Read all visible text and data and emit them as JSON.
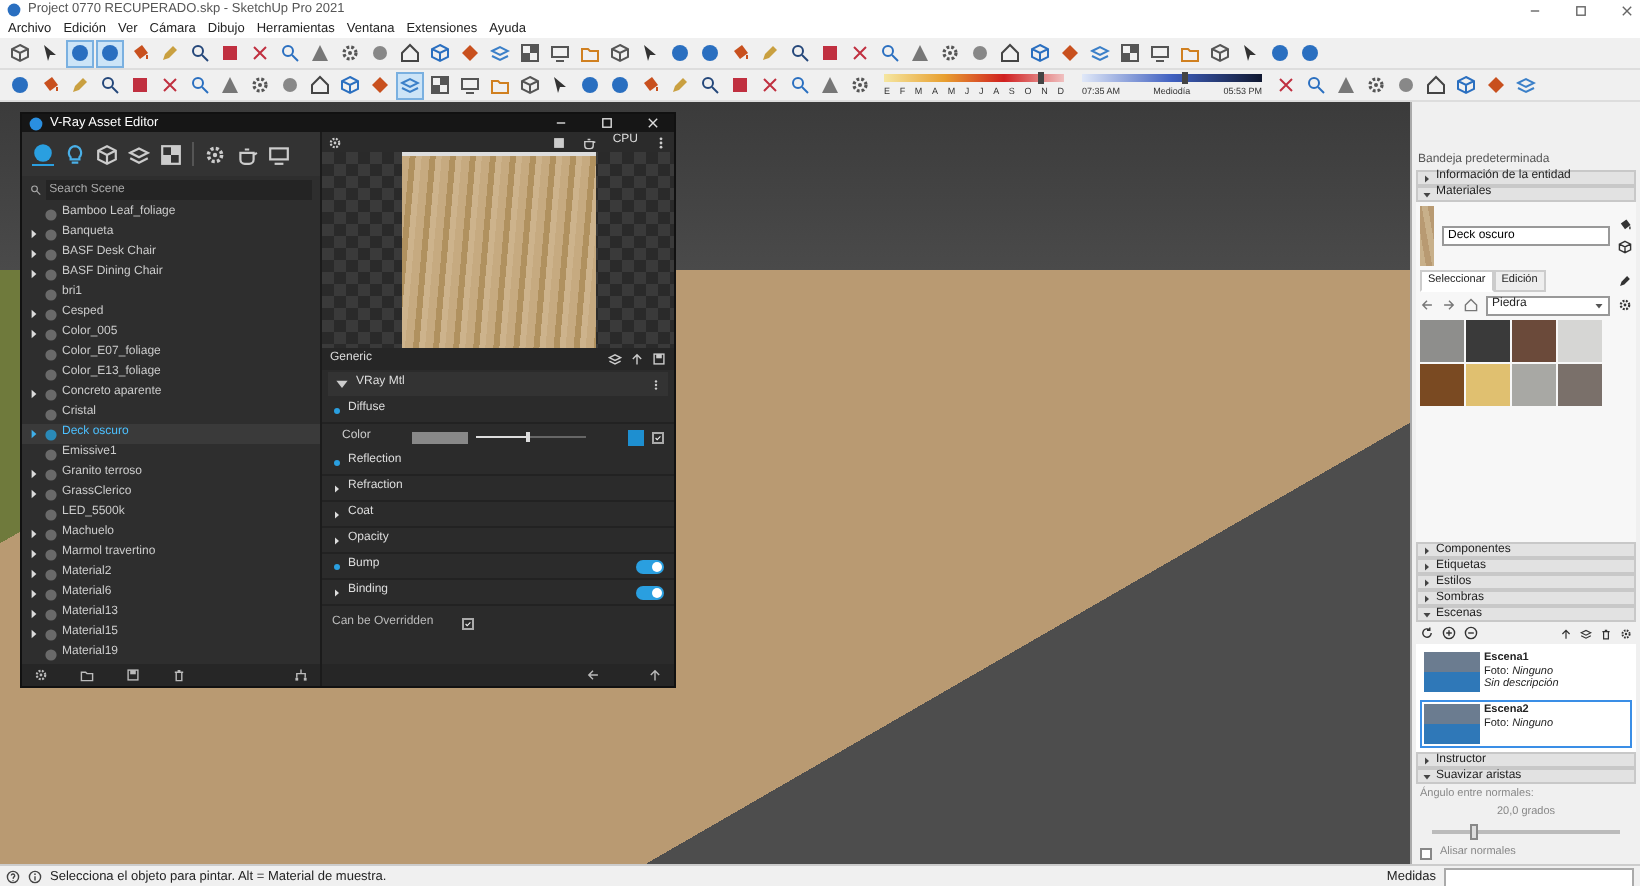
{
  "window": {
    "title": "Project 0770 RECUPERADO.skp - SketchUp Pro 2021"
  },
  "menu": [
    "Archivo",
    "Edición",
    "Ver",
    "Cámara",
    "Dibujo",
    "Herramientas",
    "Ventana",
    "Extensiones",
    "Ayuda"
  ],
  "toolbar_rows": [
    {
      "buttons": [
        {
          "selected": false
        },
        {
          "selected": false
        },
        {
          "selected": true
        },
        {
          "selected": true
        },
        {
          "selected": false
        },
        {
          "selected": false
        },
        {
          "selected": false
        },
        {
          "selected": false
        },
        {
          "selected": false
        },
        {
          "selected": false
        },
        {
          "selected": false
        },
        {
          "selected": false
        },
        {
          "selected": false
        },
        {
          "selected": false
        },
        {
          "selected": false
        },
        {
          "selected": false
        },
        {
          "selected": false
        },
        {
          "selected": false
        },
        {
          "selected": false
        },
        {
          "selected": false
        },
        {
          "selected": false
        },
        {
          "selected": false
        },
        {
          "selected": false
        },
        {
          "selected": false
        },
        {
          "selected": false
        },
        {
          "selected": false
        },
        {
          "selected": false
        },
        {
          "selected": false
        },
        {
          "selected": false
        },
        {
          "selected": false
        },
        {
          "selected": false
        },
        {
          "selected": false
        },
        {
          "selected": false
        },
        {
          "selected": false
        },
        {
          "selected": false
        },
        {
          "selected": false
        },
        {
          "selected": false
        },
        {
          "selected": false
        },
        {
          "selected": false
        },
        {
          "selected": false
        },
        {
          "selected": false
        },
        {
          "selected": false
        },
        {
          "selected": false
        },
        {
          "selected": false
        }
      ]
    },
    {
      "buttons_left": [
        {
          "selected": false
        },
        {
          "selected": false
        },
        {
          "selected": false
        },
        {
          "selected": false
        },
        {
          "selected": false
        },
        {
          "selected": false
        },
        {
          "selected": false
        },
        {
          "selected": false
        },
        {
          "selected": false
        },
        {
          "selected": false
        },
        {
          "selected": false
        },
        {
          "selected": false
        },
        {
          "selected": false
        },
        {
          "selected": true
        },
        {
          "selected": false
        },
        {
          "selected": false
        },
        {
          "selected": false
        },
        {
          "selected": false
        },
        {
          "selected": false
        },
        {
          "selected": false
        },
        {
          "selected": false
        },
        {
          "selected": false
        },
        {
          "selected": false
        },
        {
          "selected": false
        },
        {
          "selected": false
        },
        {
          "selected": false
        },
        {
          "selected": false
        },
        {
          "selected": false
        },
        {
          "selected": false
        }
      ],
      "date_slider": {
        "labels": [
          "E",
          "F",
          "M",
          "A",
          "M",
          "J",
          "J",
          "A",
          "S",
          "O",
          "N",
          "D"
        ],
        "level": 0.85
      },
      "time_slider": {
        "start": "07:35 AM",
        "middle": "Mediodía",
        "end": "05:53 PM",
        "level": 0.55
      },
      "buttons_right": [
        {
          "selected": false
        },
        {
          "selected": false
        },
        {
          "selected": false
        },
        {
          "selected": false
        },
        {
          "selected": false
        },
        {
          "selected": false
        },
        {
          "selected": false
        },
        {
          "selected": false
        },
        {
          "selected": false
        }
      ]
    }
  ],
  "vray": {
    "title": "V-Ray Asset Editor",
    "categories": [
      {
        "selected": true
      },
      {
        "selected": false
      },
      {
        "selected": false
      },
      {
        "selected": false
      },
      {
        "selected": false
      }
    ],
    "search": {
      "placeholder": "Search Scene"
    },
    "materials": [
      {
        "name": "Bamboo Leaf_foliage",
        "expandable": false,
        "selected": false
      },
      {
        "name": "Banqueta",
        "expandable": true,
        "selected": false
      },
      {
        "name": "BASF Desk Chair",
        "expandable": true,
        "selected": false
      },
      {
        "name": "BASF Dining Chair",
        "expandable": true,
        "selected": false
      },
      {
        "name": "bri1",
        "expandable": false,
        "selected": false
      },
      {
        "name": "Cesped",
        "expandable": true,
        "selected": false
      },
      {
        "name": "Color_005",
        "expandable": true,
        "selected": false
      },
      {
        "name": "Color_E07_foliage",
        "expandable": false,
        "selected": false
      },
      {
        "name": "Color_E13_foliage",
        "expandable": false,
        "selected": false
      },
      {
        "name": "Concreto aparente",
        "expandable": true,
        "selected": false
      },
      {
        "name": "Cristal",
        "expandable": false,
        "selected": false
      },
      {
        "name": "Deck oscuro",
        "expandable": true,
        "selected": true
      },
      {
        "name": "Emissive1",
        "expandable": false,
        "selected": false
      },
      {
        "name": "Granito terroso",
        "expandable": true,
        "selected": false
      },
      {
        "name": "GrassClerico",
        "expandable": true,
        "selected": false
      },
      {
        "name": "LED_5500k",
        "expandable": false,
        "selected": false
      },
      {
        "name": "Machuelo",
        "expandable": true,
        "selected": false
      },
      {
        "name": "Marmol travertino",
        "expandable": true,
        "selected": false
      },
      {
        "name": "Material2",
        "expandable": true,
        "selected": false
      },
      {
        "name": "Material6",
        "expandable": true,
        "selected": false
      },
      {
        "name": "Material13",
        "expandable": true,
        "selected": false
      },
      {
        "name": "Material15",
        "expandable": true,
        "selected": false
      },
      {
        "name": "Material19",
        "expandable": false,
        "selected": false
      }
    ],
    "renderer": "CPU",
    "header": "Generic",
    "material_type": "VRay Mtl",
    "sections": [
      {
        "label": "Diffuse",
        "kind": "plain",
        "expanded": true,
        "modified": true
      },
      {
        "label": "Reflection",
        "kind": "plain",
        "expanded": false,
        "modified": true
      },
      {
        "label": "Refraction",
        "kind": "plain",
        "expanded": false,
        "modified": false
      },
      {
        "label": "Coat",
        "kind": "plain",
        "expanded": false,
        "modified": false
      },
      {
        "label": "Opacity",
        "kind": "plain",
        "expanded": false,
        "modified": false
      },
      {
        "label": "Bump",
        "kind": "switch",
        "expanded": false,
        "modified": true,
        "on": true
      },
      {
        "label": "Binding",
        "kind": "switch",
        "expanded": false,
        "modified": false,
        "on": true
      }
    ],
    "color_row": {
      "label": "Color",
      "level": 0.45,
      "checked": true
    },
    "override": {
      "label": "Can be Overridden",
      "checked": true
    }
  },
  "tray": {
    "title": "Bandeja predeterminada",
    "panels": [
      {
        "kind": "section",
        "title": "Información de la entidad",
        "expanded": false
      },
      {
        "kind": "materials",
        "title": "Materiales",
        "expanded": true,
        "name_value": "Deck oscuro",
        "tabs": [
          {
            "label": "Seleccionar",
            "selected": true
          },
          {
            "label": "Edición",
            "selected": false
          }
        ],
        "library": "Piedra",
        "swatches": [
          {
            "color": "#8e8e8c"
          },
          {
            "color": "#3a3a3a"
          },
          {
            "color": "#6b4a3a"
          },
          {
            "color": "#d6d6d4"
          },
          {
            "color": "#7a4a22"
          },
          {
            "color": "#e0c070"
          },
          {
            "color": "#a8a8a4"
          },
          {
            "color": "#7a706a"
          }
        ]
      },
      {
        "kind": "section",
        "title": "Componentes",
        "expanded": false
      },
      {
        "kind": "section",
        "title": "Etiquetas",
        "expanded": false
      },
      {
        "kind": "section",
        "title": "Estilos",
        "expanded": false
      },
      {
        "kind": "section",
        "title": "Sombras",
        "expanded": false
      },
      {
        "kind": "scenes",
        "title": "Escenas",
        "expanded": true,
        "scenes": [
          {
            "name": "Escena1",
            "photo": "Foto: *Ninguno*",
            "description": "Sin descripción",
            "selected": false
          },
          {
            "name": "Escena2",
            "photo": "Foto: *Ninguno*",
            "selected": true
          }
        ]
      },
      {
        "kind": "section",
        "title": "Instructor",
        "expanded": false
      },
      {
        "kind": "smooth",
        "title": "Suavizar aristas",
        "expanded": true,
        "angle_label": "Ángulo entre normales:",
        "angle_value": "20,0 grados",
        "level": 0.2,
        "options": [
          {
            "label": "Alisar normales",
            "checked": false
          }
        ]
      }
    ]
  },
  "status_bar": {
    "hint": "Selecciona el objeto para pintar. Alt = Material de muestra.",
    "measurements_label": "Medidas"
  }
}
